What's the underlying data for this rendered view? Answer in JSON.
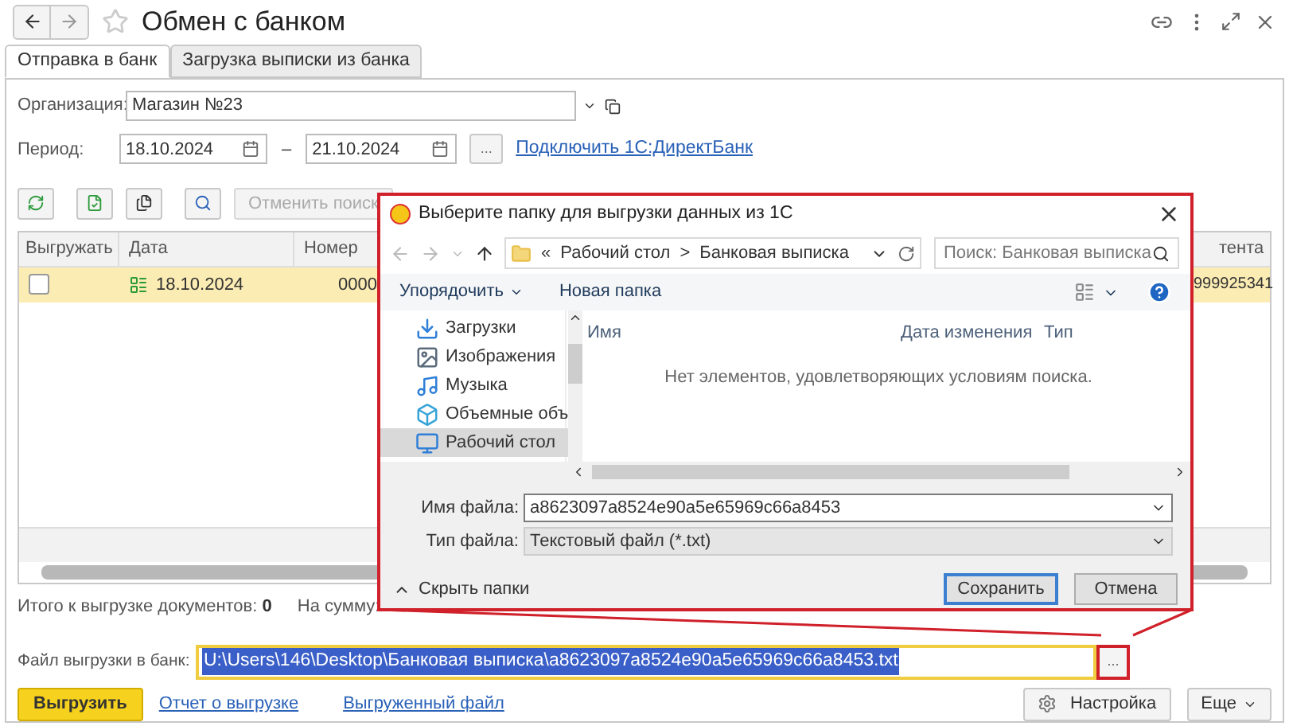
{
  "window": {
    "title": "Обмен с банком"
  },
  "tabs": [
    {
      "label": "Отправка в банк",
      "selected": true
    },
    {
      "label": "Загрузка выписки из банка",
      "selected": false
    }
  ],
  "organization": {
    "label": "Организация:",
    "value": "Магазин №23"
  },
  "period": {
    "label": "Период:",
    "from": "18.10.2024",
    "dash": "–",
    "to": "21.10.2024",
    "more": "...",
    "link": "Подключить 1С:ДиректБанк"
  },
  "toolbar": {
    "cancel_search": {
      "label": "Отменить поиск",
      "disabled": true
    }
  },
  "table": {
    "columns": [
      "Выгружать",
      "Дата",
      "Номер",
      "тента"
    ],
    "rows": [
      {
        "selected": true,
        "checked": false,
        "date": "18.10.2024",
        "number": "0000",
        "column_4": "999925341"
      }
    ]
  },
  "totals": {
    "label": "Итого к выгрузке документов:",
    "count": "0",
    "sum_label": "На сумму:"
  },
  "file": {
    "label": "Файл выгрузки в банк:",
    "value": "U:\\Users\\146\\Desktop\\Банковая выписка\\a8623097a8524e90a5e65969c66a8453.txt",
    "button": "..."
  },
  "actions": {
    "primary": "Выгрузить",
    "links": [
      "Отчет о выгрузке",
      "Выгруженный файл"
    ],
    "settings": "Настройка",
    "more": "Еще"
  },
  "dialog": {
    "title": "Выберите папку для выгрузки данных из 1С",
    "breadcrumbs": [
      "Рабочий стол",
      "Банковая выписка"
    ],
    "breadcrumb_prefix": "«",
    "separator": ">",
    "search_placeholder": "Поиск: Банковая выписка",
    "toolbar": [
      "Упорядочить",
      "Новая папка"
    ],
    "tree": [
      {
        "label": "Загрузки",
        "kind": "downloads",
        "selected": false
      },
      {
        "label": "Изображения",
        "kind": "pictures",
        "selected": false
      },
      {
        "label": "Музыка",
        "kind": "music",
        "selected": false
      },
      {
        "label": "Объемные объ",
        "kind": "objects",
        "selected": false
      },
      {
        "label": "Рабочий стол",
        "kind": "desktop",
        "selected": true
      }
    ],
    "columns": [
      "Имя",
      "Дата изменения",
      "Тип"
    ],
    "empty": "Нет элементов, удовлетворяющих условиям поиска.",
    "filename": {
      "label": "Имя файла:",
      "value": "a8623097a8524e90a5e65969c66a8453"
    },
    "filetype": {
      "label": "Тип файла:",
      "value": "Текстовый файл (*.txt)"
    },
    "hide_folders": "Скрыть папки",
    "buttons": [
      "Сохранить",
      "Отмена"
    ]
  }
}
